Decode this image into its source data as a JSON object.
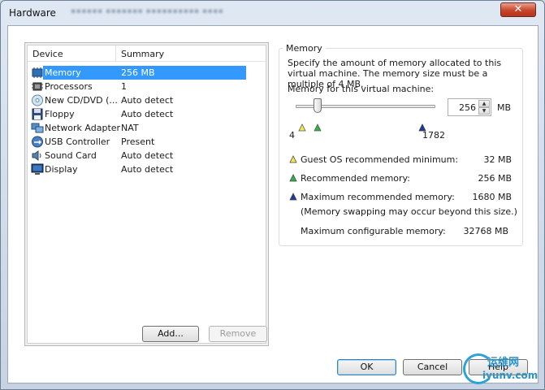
{
  "window": {
    "title": "Hardware",
    "close_symbol": "✕"
  },
  "device_list": {
    "headers": {
      "device": "Device",
      "summary": "Summary"
    },
    "items": [
      {
        "icon": "memory-chip-icon",
        "device": "Memory",
        "summary": "256 MB",
        "selected": true
      },
      {
        "icon": "processor-icon",
        "device": "Processors",
        "summary": "1"
      },
      {
        "icon": "cd-dvd-icon",
        "device": "New CD/DVD (...",
        "summary": "Auto detect"
      },
      {
        "icon": "floppy-icon",
        "device": "Floppy",
        "summary": "Auto detect"
      },
      {
        "icon": "network-adapter-icon",
        "device": "Network Adapter",
        "summary": "NAT"
      },
      {
        "icon": "usb-icon",
        "device": "USB Controller",
        "summary": "Present"
      },
      {
        "icon": "sound-card-icon",
        "device": "Sound Card",
        "summary": "Auto detect"
      },
      {
        "icon": "display-icon",
        "device": "Display",
        "summary": "Auto detect"
      }
    ]
  },
  "list_buttons": {
    "add": "Add...",
    "remove": "Remove"
  },
  "memory": {
    "group_title": "Memory",
    "description": "Specify the amount of memory allocated to this virtual machine. The memory size must be a multiple of 4 MB.",
    "vm_label": "Memory for this virtual machine:",
    "value": "256",
    "unit": "MB",
    "slider": {
      "min": "4",
      "max": "1782"
    },
    "legend": [
      {
        "color": "#f5e84a",
        "label": "Guest OS recommended minimum:",
        "value": "32 MB"
      },
      {
        "color": "#2fb344",
        "label": "Recommended memory:",
        "value": "256 MB"
      },
      {
        "color": "#1f3b9a",
        "label": "Maximum recommended memory:",
        "value": "1680 MB"
      }
    ],
    "swap_note": "(Memory swapping may occur beyond this size.)",
    "max_config_label": "Maximum configurable memory:",
    "max_config_value": "32768 MB"
  },
  "dialog_buttons": {
    "ok": "OK",
    "cancel": "Cancel",
    "help": "Help"
  },
  "watermark": {
    "top": "运维网",
    "bottom": "iyunv.com"
  }
}
